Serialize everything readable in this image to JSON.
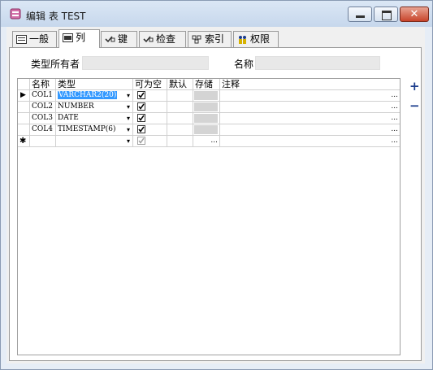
{
  "window": {
    "title": "编辑 表 TEST",
    "close_glyph": "✕"
  },
  "tabs": [
    {
      "label": "一般",
      "icon": "form-icon"
    },
    {
      "label": "列",
      "icon": "columns-icon",
      "active": true
    },
    {
      "label": "键",
      "icon": "key-check-icon"
    },
    {
      "label": "检查",
      "icon": "check-constraint-icon"
    },
    {
      "label": "索引",
      "icon": "index-icon"
    },
    {
      "label": "权限",
      "icon": "users-privileges-icon"
    }
  ],
  "form": {
    "owner_label": "类型所有者",
    "owner_value": "",
    "name_label": "名称",
    "name_value": ""
  },
  "grid": {
    "headers": [
      "名称",
      "类型",
      "可为空",
      "默认",
      "存储",
      "注释"
    ],
    "rows": [
      {
        "name": "COL1",
        "type": "VARCHAR2(20)",
        "nullable": true,
        "default": "",
        "comment": "",
        "current": true
      },
      {
        "name": "COL2",
        "type": "NUMBER",
        "nullable": true,
        "default": "",
        "comment": ""
      },
      {
        "name": "COL3",
        "type": "DATE",
        "nullable": true,
        "default": "",
        "comment": ""
      },
      {
        "name": "COL4",
        "type": "TIMESTAMP(6)",
        "nullable": true,
        "default": "",
        "comment": ""
      }
    ],
    "new_row_marker": "✱",
    "dropdown_glyph": "▾",
    "ellipsis": "...",
    "current_marker": "▶"
  },
  "side_buttons": {
    "add": "+",
    "remove": "−"
  },
  "colors": {
    "selection": "#3399ff",
    "titlebar": "#c6d7ec",
    "close_button": "#c8442a",
    "side_buttons": "#1b3c8c"
  }
}
